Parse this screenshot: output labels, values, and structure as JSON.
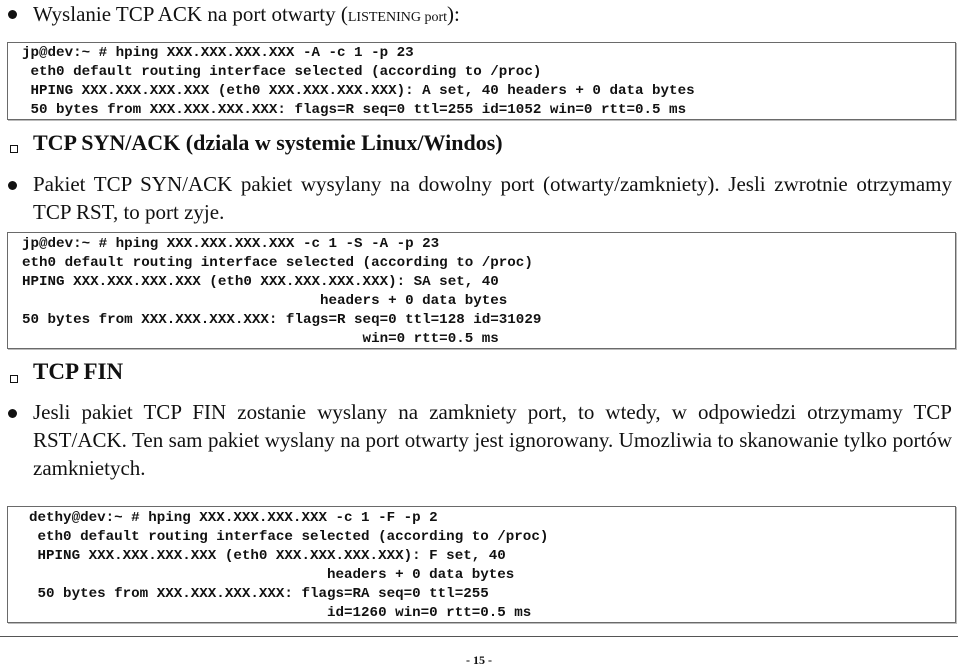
{
  "section1": {
    "bullet_text_main": "Wyslanie TCP ACK na port otwarty (",
    "bullet_text_smallcaps": "LISTENING port",
    "bullet_text_end": "):",
    "code_lines": [
      "jp@dev:~ # hping XXX.XXX.XXX.XXX -A -c 1 -p 23",
      " eth0 default routing interface selected (according to /proc)",
      " HPING XXX.XXX.XXX.XXX (eth0 XXX.XXX.XXX.XXX): A set, 40 headers + 0 data bytes",
      " 50 bytes from XXX.XXX.XXX.XXX: flags=R seq=0 ttl=255 id=1052 win=0 rtt=0.5 ms"
    ]
  },
  "section2": {
    "heading": "TCP SYN/ACK (dziala w systemie Linux/Windos)",
    "paragraph": "Pakiet TCP SYN/ACK pakiet wysylany na dowolny port (otwarty/zamkniety). Jesli zwrotnie otrzymamy TCP RST, to port zyje.",
    "code_lines": [
      "jp@dev:~ # hping XXX.XXX.XXX.XXX -c 1 -S -A -p 23",
      "eth0 default routing interface selected (according to /proc)",
      "HPING XXX.XXX.XXX.XXX (eth0 XXX.XXX.XXX.XXX): SA set, 40",
      "                                   headers + 0 data bytes",
      "50 bytes from XXX.XXX.XXX.XXX: flags=R seq=0 ttl=128 id=31029",
      "                                        win=0 rtt=0.5 ms"
    ]
  },
  "section3": {
    "heading": "TCP FIN",
    "paragraph": "Jesli pakiet TCP FIN zostanie wyslany na zamkniety port, to wtedy, w odpowiedzi otrzymamy TCP RST/ACK. Ten sam pakiet wyslany na port otwarty jest ignorowany. Umozliwia to skanowanie tylko portów zamknietych.",
    "code_lines": [
      "dethy@dev:~ # hping XXX.XXX.XXX.XXX -c 1 -F -p 2",
      " eth0 default routing interface selected (according to /proc)",
      " HPING XXX.XXX.XXX.XXX (eth0 XXX.XXX.XXX.XXX): F set, 40",
      "                                   headers + 0 data bytes",
      " 50 bytes from XXX.XXX.XXX.XXX: flags=RA seq=0 ttl=255",
      "                                   id=1260 win=0 rtt=0.5 ms"
    ]
  },
  "footer": {
    "page_number": "- 15 -"
  }
}
